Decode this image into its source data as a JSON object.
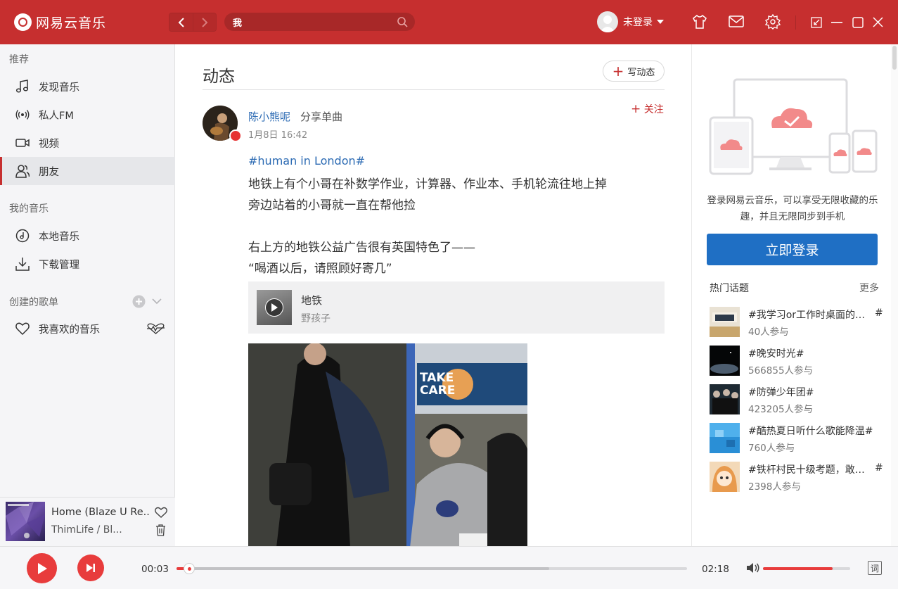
{
  "app": {
    "name": "网易云音乐",
    "brand_color": "#c62f2f"
  },
  "header": {
    "search_value": "我",
    "user_name": "未登录",
    "icons": [
      "back-icon",
      "forward-icon",
      "search-icon",
      "skin-icon",
      "mail-icon",
      "settings-icon",
      "mini-mode-icon",
      "minimize-icon",
      "maximize-icon",
      "close-icon"
    ]
  },
  "sidebar": {
    "section_recommend": "推荐",
    "recommend_items": [
      {
        "label": "发现音乐",
        "icon": "music-note-icon"
      },
      {
        "label": "私人FM",
        "icon": "radio-icon"
      },
      {
        "label": "视频",
        "icon": "video-icon"
      },
      {
        "label": "朋友",
        "icon": "friends-icon",
        "active": true
      }
    ],
    "section_my_music": "我的音乐",
    "my_music_items": [
      {
        "label": "本地音乐",
        "icon": "local-music-icon"
      },
      {
        "label": "下载管理",
        "icon": "download-icon"
      }
    ],
    "section_created": "创建的歌单",
    "playlists": [
      {
        "label": "我喜欢的音乐",
        "icon": "heart-icon"
      }
    ]
  },
  "now_playing": {
    "title": "Home (Blaze U Re...",
    "artist": "ThimLife / Bl..."
  },
  "main": {
    "page_title": "动态",
    "write_label": "写动态",
    "post": {
      "user": "陈小熊呢",
      "action": "分享单曲",
      "time": "1月8日 16:42",
      "follow_label": "关注",
      "hashtag": "#human in London#",
      "lines": [
        "地铁上有个小哥在补数学作业，计算器、作业本、手机轮流往地上掉",
        "旁边站着的小哥就一直在帮他捡",
        "",
        "右上方的地铁公益广告很有英国特色了——",
        "“喝酒以后，请照顾好寄几”"
      ],
      "song": {
        "name": "地铁",
        "artist": "野孩子"
      },
      "photo_ad_text": [
        "TAKE",
        "CARE"
      ]
    }
  },
  "right_panel": {
    "login_tip": "登录网易云音乐，可以享受无限收藏的乐趣，并且无限同步到手机",
    "login_button": "立即登录",
    "hot_title": "热门话题",
    "more_label": "更多",
    "topics": [
      {
        "name": "#我学习or工作时桌面的…",
        "count": "40人参与"
      },
      {
        "name": "#晚安时光#",
        "count": "566855人参与"
      },
      {
        "name": "#防弹少年团#",
        "count": "423205人参与"
      },
      {
        "name": "#酷热夏日听什么歌能降温#",
        "count": "760人参与"
      },
      {
        "name": "#铁杆村民十级考题，敢…",
        "count": "2398人参与"
      }
    ],
    "topic_trail": "#"
  },
  "player": {
    "current_time": "00:03",
    "total_time": "02:18",
    "progress_fraction": 0.025,
    "buffered_fraction": 0.73,
    "volume_fraction": 0.8,
    "lyric_label": "词"
  }
}
